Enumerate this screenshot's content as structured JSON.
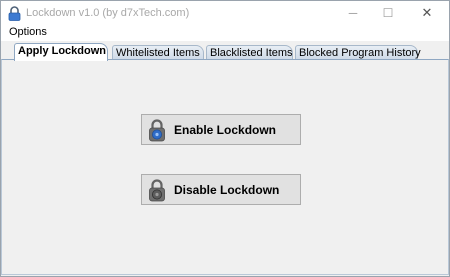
{
  "window": {
    "title": "Lockdown  v1.0 (by d7xTech.com)",
    "controls": {
      "minimize": "─",
      "maximize": "☐",
      "close": "✕"
    }
  },
  "menu": {
    "items": [
      {
        "label": "Options"
      }
    ]
  },
  "tabs": [
    {
      "label": "Apply Lockdown",
      "active": true
    },
    {
      "label": "Whitelisted Items",
      "active": false
    },
    {
      "label": "Blacklisted Items",
      "active": false
    },
    {
      "label": "Blocked Program History",
      "active": false
    }
  ],
  "actions": {
    "enable": {
      "label": "Enable Lockdown",
      "icon": "blue-padlock-icon"
    },
    "disable": {
      "label": "Disable Lockdown",
      "icon": "gray-padlock-icon"
    }
  },
  "colors": {
    "tab_border": "#8fa7c2",
    "button_face": "#e1e1e1",
    "panel_background": "#f0f0f0",
    "enable_lock_accent": "#2f6cc7",
    "disable_lock_accent": "#5c5c5c"
  }
}
